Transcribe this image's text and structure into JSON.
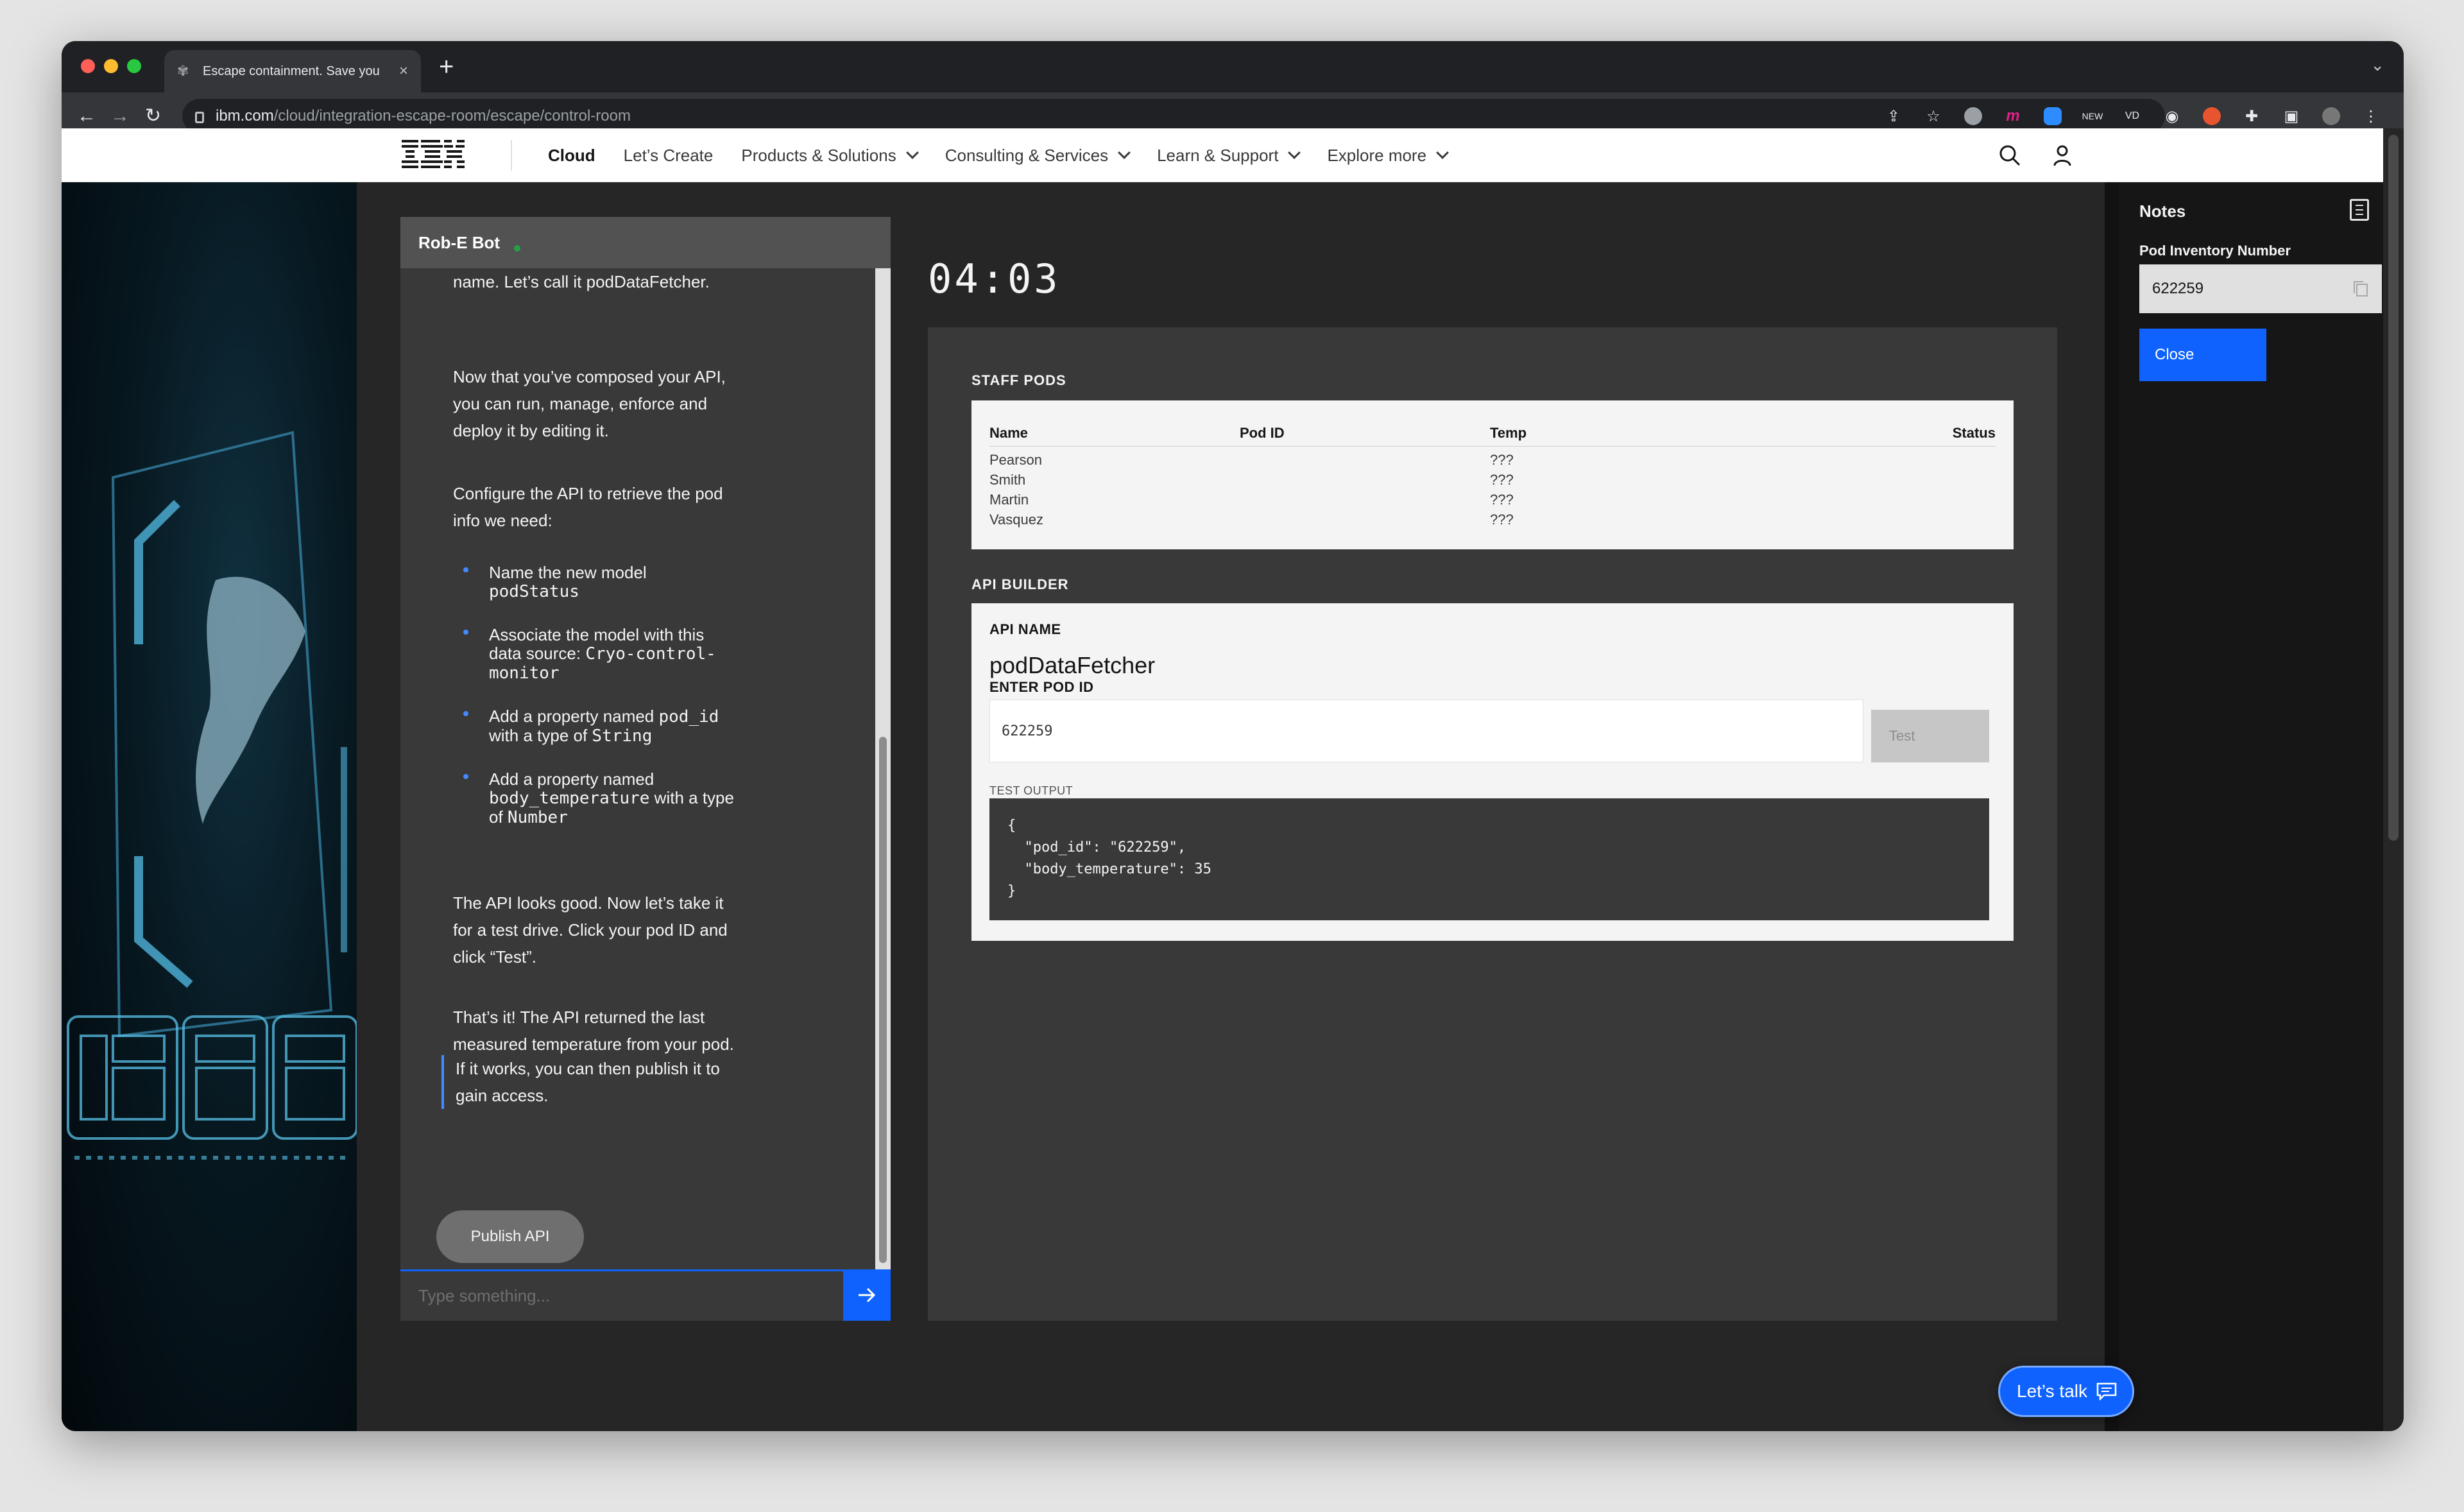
{
  "browser": {
    "tab_title": "Escape containment. Save you",
    "url_host": "ibm.com",
    "url_path": "/cloud/integration-escape-room/escape/control-room",
    "colors": {
      "traffic_red": "#ff5f57",
      "traffic_yellow": "#febc2e",
      "traffic_green": "#28c840"
    }
  },
  "masthead": {
    "logo": "IBM",
    "nav": [
      {
        "label": "Cloud",
        "active": true,
        "dropdown": false
      },
      {
        "label": "Let’s Create",
        "active": false,
        "dropdown": false
      },
      {
        "label": "Products & Solutions",
        "active": false,
        "dropdown": true
      },
      {
        "label": "Consulting & Services",
        "active": false,
        "dropdown": true
      },
      {
        "label": "Learn & Support",
        "active": false,
        "dropdown": true
      },
      {
        "label": "Explore more",
        "active": false,
        "dropdown": true
      }
    ]
  },
  "chat": {
    "title": "Rob-E Bot",
    "messages": [
      "name. Let’s call it podDataFetcher.",
      "Now that you’ve composed your API, you can run, manage, enforce and deploy it by editing it.",
      "Configure the API to retrieve the pod info we need:"
    ],
    "bullets": [
      {
        "text": "Name the new model ",
        "code": "podStatus",
        "suffix": ""
      },
      {
        "text": "Associate the model with this data source: ",
        "code": "Cryo-control-monitor",
        "suffix": ""
      },
      {
        "text": "Add a property named ",
        "code": "pod_id",
        "suffix": " with a type of ",
        "code2": "String"
      },
      {
        "text": "Add a property named ",
        "code": "body_temperature",
        "suffix": " with a type of ",
        "code2": "Number"
      }
    ],
    "messages_after": [
      "The API looks good. Now let’s take it for a test drive. Click your pod ID and click “Test”.",
      "That’s it! The API returned the last measured temperature from your pod."
    ],
    "quote": "If it works, you can then publish it to gain access.",
    "publish_label": "Publish API",
    "input_placeholder": "Type something..."
  },
  "timer": "04:03",
  "staff_pods": {
    "title": "STAFF PODS",
    "columns": [
      "Name",
      "Pod ID",
      "Temp",
      "Status"
    ],
    "rows": [
      {
        "name": "Pearson",
        "pod_id": "",
        "temp": "???",
        "status": ""
      },
      {
        "name": "Smith",
        "pod_id": "",
        "temp": "???",
        "status": ""
      },
      {
        "name": "Martin",
        "pod_id": "",
        "temp": "???",
        "status": ""
      },
      {
        "name": "Vasquez",
        "pod_id": "",
        "temp": "???",
        "status": ""
      }
    ]
  },
  "api_builder": {
    "title": "API BUILDER",
    "name_label": "API NAME",
    "name_value": "podDataFetcher",
    "pod_label": "ENTER POD ID",
    "pod_value": "622259",
    "test_label": "Test",
    "output_label": "TEST OUTPUT",
    "output": "{\n  \"pod_id\": \"622259\",\n  \"body_temperature\": 35\n}"
  },
  "notes": {
    "title": "Notes",
    "field_label": "Pod Inventory Number",
    "field_value": "622259",
    "close_label": "Close"
  },
  "lets_talk": "Let’s talk"
}
